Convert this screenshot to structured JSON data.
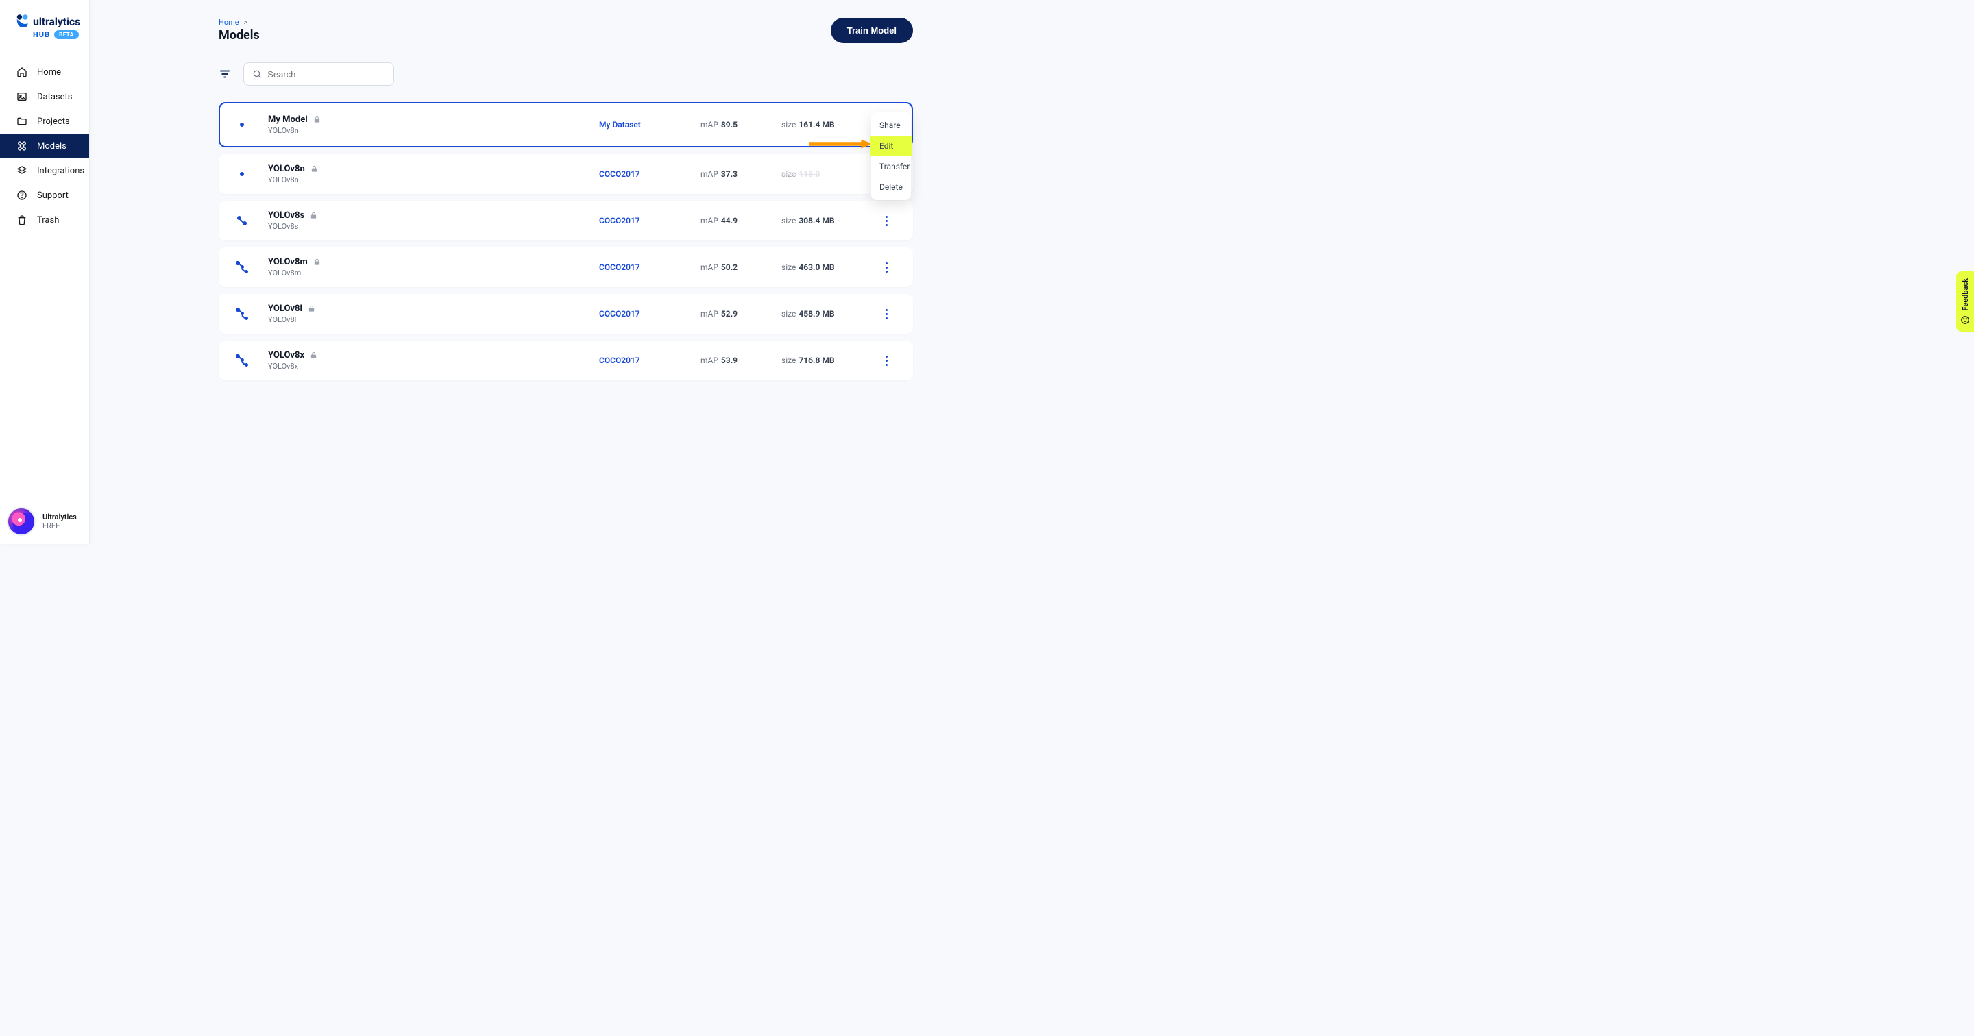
{
  "brand": {
    "name": "ultralytics",
    "hub": "HUB",
    "beta": "BETA"
  },
  "sidebar": {
    "items": [
      {
        "label": "Home"
      },
      {
        "label": "Datasets"
      },
      {
        "label": "Projects"
      },
      {
        "label": "Models"
      },
      {
        "label": "Integrations"
      },
      {
        "label": "Support"
      },
      {
        "label": "Trash"
      }
    ],
    "user": {
      "name": "Ultralytics",
      "plan": "FREE"
    }
  },
  "breadcrumb": {
    "home": "Home",
    "chev": ">"
  },
  "page": {
    "title": "Models"
  },
  "actions": {
    "train": "Train Model"
  },
  "search": {
    "placeholder": "Search"
  },
  "models": [
    {
      "name": "My Model",
      "arch": "YOLOv8n",
      "dataset": "My Dataset",
      "map": "89.5",
      "size": "161.4 MB",
      "locked": true,
      "selected": true,
      "icon": "dot"
    },
    {
      "name": "YOLOv8n",
      "arch": "YOLOv8n",
      "dataset": "COCO2017",
      "map": "37.3",
      "size": "118.0",
      "locked": true,
      "selected": false,
      "icon": "dot",
      "sizeHidden": true
    },
    {
      "name": "YOLOv8s",
      "arch": "YOLOv8s",
      "dataset": "COCO2017",
      "map": "44.9",
      "size": "308.4 MB",
      "locked": true,
      "selected": false,
      "icon": "sm"
    },
    {
      "name": "YOLOv8m",
      "arch": "YOLOv8m",
      "dataset": "COCO2017",
      "map": "50.2",
      "size": "463.0 MB",
      "locked": true,
      "selected": false,
      "icon": "md"
    },
    {
      "name": "YOLOv8l",
      "arch": "YOLOv8l",
      "dataset": "COCO2017",
      "map": "52.9",
      "size": "458.9 MB",
      "locked": true,
      "selected": false,
      "icon": "md"
    },
    {
      "name": "YOLOv8x",
      "arch": "YOLOv8x",
      "dataset": "COCO2017",
      "map": "53.9",
      "size": "716.8 MB",
      "locked": true,
      "selected": false,
      "icon": "md"
    }
  ],
  "labels": {
    "map": "mAP",
    "size": "size"
  },
  "dropdown": {
    "items": [
      {
        "label": "Share"
      },
      {
        "label": "Edit",
        "highlight": true
      },
      {
        "label": "Transfer"
      },
      {
        "label": "Delete"
      }
    ]
  },
  "feedback": {
    "label": "Feedback"
  }
}
